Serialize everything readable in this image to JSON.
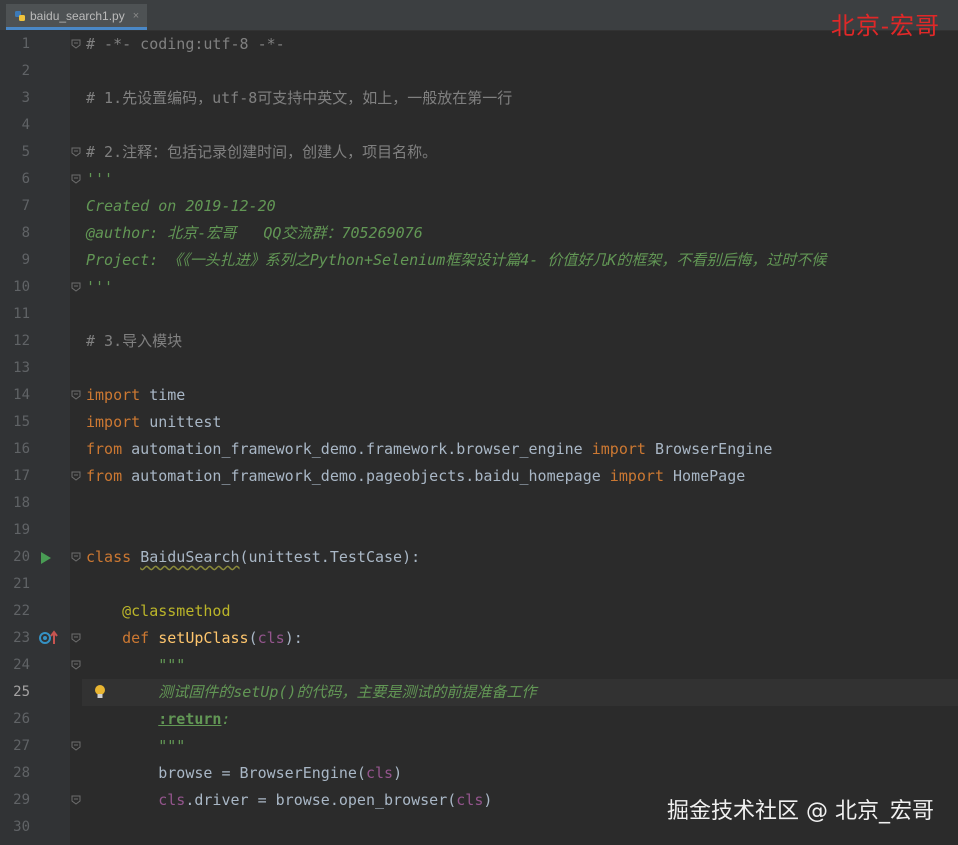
{
  "tab": {
    "filename": "baidu_search1.py",
    "close": "×"
  },
  "watermark_top": "北京-宏哥",
  "watermark_bottom": "掘金技术社区 @ 北京_宏哥",
  "current_line": 25,
  "lines": [
    {
      "n": "1",
      "segs": [
        [
          "c-comment",
          "# -*- coding:utf-8 -*-"
        ]
      ]
    },
    {
      "n": "2",
      "segs": []
    },
    {
      "n": "3",
      "segs": [
        [
          "c-comment",
          "# 1.先设置编码，utf-8可支持中英文，如上，一般放在第一行"
        ]
      ]
    },
    {
      "n": "4",
      "segs": []
    },
    {
      "n": "5",
      "segs": [
        [
          "c-comment",
          "# 2.注释：包括记录创建时间，创建人，项目名称。"
        ]
      ]
    },
    {
      "n": "6",
      "segs": [
        [
          "c-doc",
          "'''"
        ]
      ]
    },
    {
      "n": "7",
      "segs": [
        [
          "c-doc",
          "Created on 2019-12-20"
        ]
      ]
    },
    {
      "n": "8",
      "segs": [
        [
          "c-doc",
          "@author: 北京-宏哥   QQ交流群：705269076"
        ]
      ]
    },
    {
      "n": "9",
      "segs": [
        [
          "c-doc",
          "Project: 《《一头扎进》系列之Python+Selenium框架设计篇4- 价值好几K的框架，不看别后悔，过时不候"
        ]
      ]
    },
    {
      "n": "10",
      "segs": [
        [
          "c-doc",
          "'''"
        ]
      ]
    },
    {
      "n": "11",
      "segs": []
    },
    {
      "n": "12",
      "segs": [
        [
          "c-comment",
          "# 3.导入模块"
        ]
      ]
    },
    {
      "n": "13",
      "segs": []
    },
    {
      "n": "14",
      "segs": [
        [
          "c-kw",
          "import "
        ],
        [
          "c-txt",
          "time"
        ]
      ]
    },
    {
      "n": "15",
      "segs": [
        [
          "c-kw",
          "import "
        ],
        [
          "c-txt",
          "unittest"
        ]
      ]
    },
    {
      "n": "16",
      "segs": [
        [
          "c-kw",
          "from "
        ],
        [
          "c-txt",
          "automation_framework_demo.framework.browser_engine "
        ],
        [
          "c-kw",
          "import "
        ],
        [
          "c-txt",
          "BrowserEngine"
        ]
      ]
    },
    {
      "n": "17",
      "segs": [
        [
          "c-kw",
          "from "
        ],
        [
          "c-txt",
          "automation_framework_demo.pageobjects.baidu_homepage "
        ],
        [
          "c-kw",
          "import "
        ],
        [
          "c-txt",
          "HomePage"
        ]
      ]
    },
    {
      "n": "18",
      "segs": []
    },
    {
      "n": "19",
      "segs": []
    },
    {
      "n": "20",
      "segs": [
        [
          "c-kw",
          "class "
        ],
        [
          "c-txt squiggle",
          "BaiduSearch"
        ],
        [
          "c-txt",
          "(unittest.TestCase):"
        ]
      ]
    },
    {
      "n": "21",
      "segs": []
    },
    {
      "n": "22",
      "segs": [
        [
          "c-txt",
          "    "
        ],
        [
          "c-deco",
          "@classmethod"
        ]
      ]
    },
    {
      "n": "23",
      "segs": [
        [
          "c-txt",
          "    "
        ],
        [
          "c-kw",
          "def "
        ],
        [
          "c-fn",
          "setUpClass"
        ],
        [
          "c-txt",
          "("
        ],
        [
          "c-self",
          "cls"
        ],
        [
          "c-txt",
          "):"
        ]
      ]
    },
    {
      "n": "24",
      "segs": [
        [
          "c-txt",
          "        "
        ],
        [
          "c-doc",
          "\"\"\""
        ]
      ]
    },
    {
      "n": "25",
      "segs": [
        [
          "c-txt",
          "        "
        ],
        [
          "c-doc",
          "测试固件的setUp()的代码，主要是测试的前提准备工作"
        ]
      ]
    },
    {
      "n": "26",
      "segs": [
        [
          "c-txt",
          "        "
        ],
        [
          "doc-tag",
          ":return"
        ],
        [
          "c-doc",
          ":"
        ]
      ]
    },
    {
      "n": "27",
      "segs": [
        [
          "c-txt",
          "        "
        ],
        [
          "c-doc",
          "\"\"\""
        ]
      ]
    },
    {
      "n": "28",
      "segs": [
        [
          "c-txt",
          "        browse = BrowserEngine("
        ],
        [
          "c-self",
          "cls"
        ],
        [
          "c-txt",
          ")"
        ]
      ]
    },
    {
      "n": "29",
      "segs": [
        [
          "c-txt",
          "        "
        ],
        [
          "c-self",
          "cls"
        ],
        [
          "c-txt",
          ".driver = browse.open_browser("
        ],
        [
          "c-self",
          "cls"
        ],
        [
          "c-txt",
          ")"
        ]
      ]
    },
    {
      "n": "30",
      "segs": []
    }
  ],
  "fold_lines": [
    "1",
    "5",
    "6",
    "10",
    "14",
    "17",
    "20",
    "23",
    "24",
    "27",
    "29"
  ],
  "icons": {
    "run": "run-test-icon",
    "override": "override-method-icon",
    "bulb": "intention-bulb-icon",
    "python": "python-file-icon"
  }
}
